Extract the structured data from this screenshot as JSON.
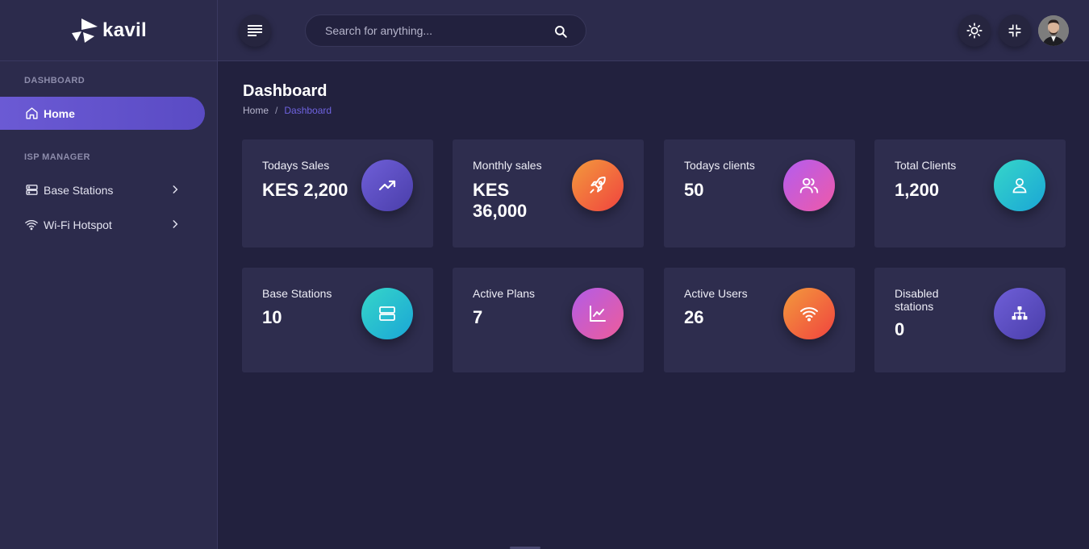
{
  "brand": {
    "name": "kavil"
  },
  "sidebar": {
    "sections": [
      {
        "title": "DASHBOARD"
      },
      {
        "title": "ISP MANAGER"
      }
    ],
    "items": [
      {
        "label": "Home",
        "icon": "home-icon",
        "active": true
      },
      {
        "label": "Base Stations",
        "icon": "server-icon"
      },
      {
        "label": "Wi-Fi Hotspot",
        "icon": "wifi-icon"
      }
    ]
  },
  "topbar": {
    "search_placeholder": "Search for anything..."
  },
  "page": {
    "title": "Dashboard",
    "breadcrumb": [
      "Home",
      "/",
      "Dashboard"
    ]
  },
  "cards": [
    {
      "label": "Todays Sales",
      "value": "KES 2,200",
      "icon": "trending-up-icon",
      "color": "#5a4bc4"
    },
    {
      "label": "Monthly sales",
      "value": "KES 36,000",
      "icon": "rocket-icon",
      "color": "#f0623f"
    },
    {
      "label": "Todays clients",
      "value": "50",
      "icon": "users-icon",
      "color": "#d55ccd"
    },
    {
      "label": "Total Clients",
      "value": "1,200",
      "icon": "user-icon",
      "color": "#28bed0"
    },
    {
      "label": "Base Stations",
      "value": "10",
      "icon": "server-icon",
      "color": "#28bed0"
    },
    {
      "label": "Active Plans",
      "value": "7",
      "icon": "line-chart-icon",
      "color": "#d55cc2"
    },
    {
      "label": "Active Users",
      "value": "26",
      "icon": "wifi-icon",
      "color": "#f0623f"
    },
    {
      "label": "Disabled stations",
      "value": "0",
      "icon": "sitemap-icon",
      "color": "#5a4bc4"
    }
  ],
  "colors": {
    "accent": "#6b5ad4",
    "background": "#22213e",
    "sidebar": "#2c2b4c",
    "card": "#2e2d4e"
  }
}
